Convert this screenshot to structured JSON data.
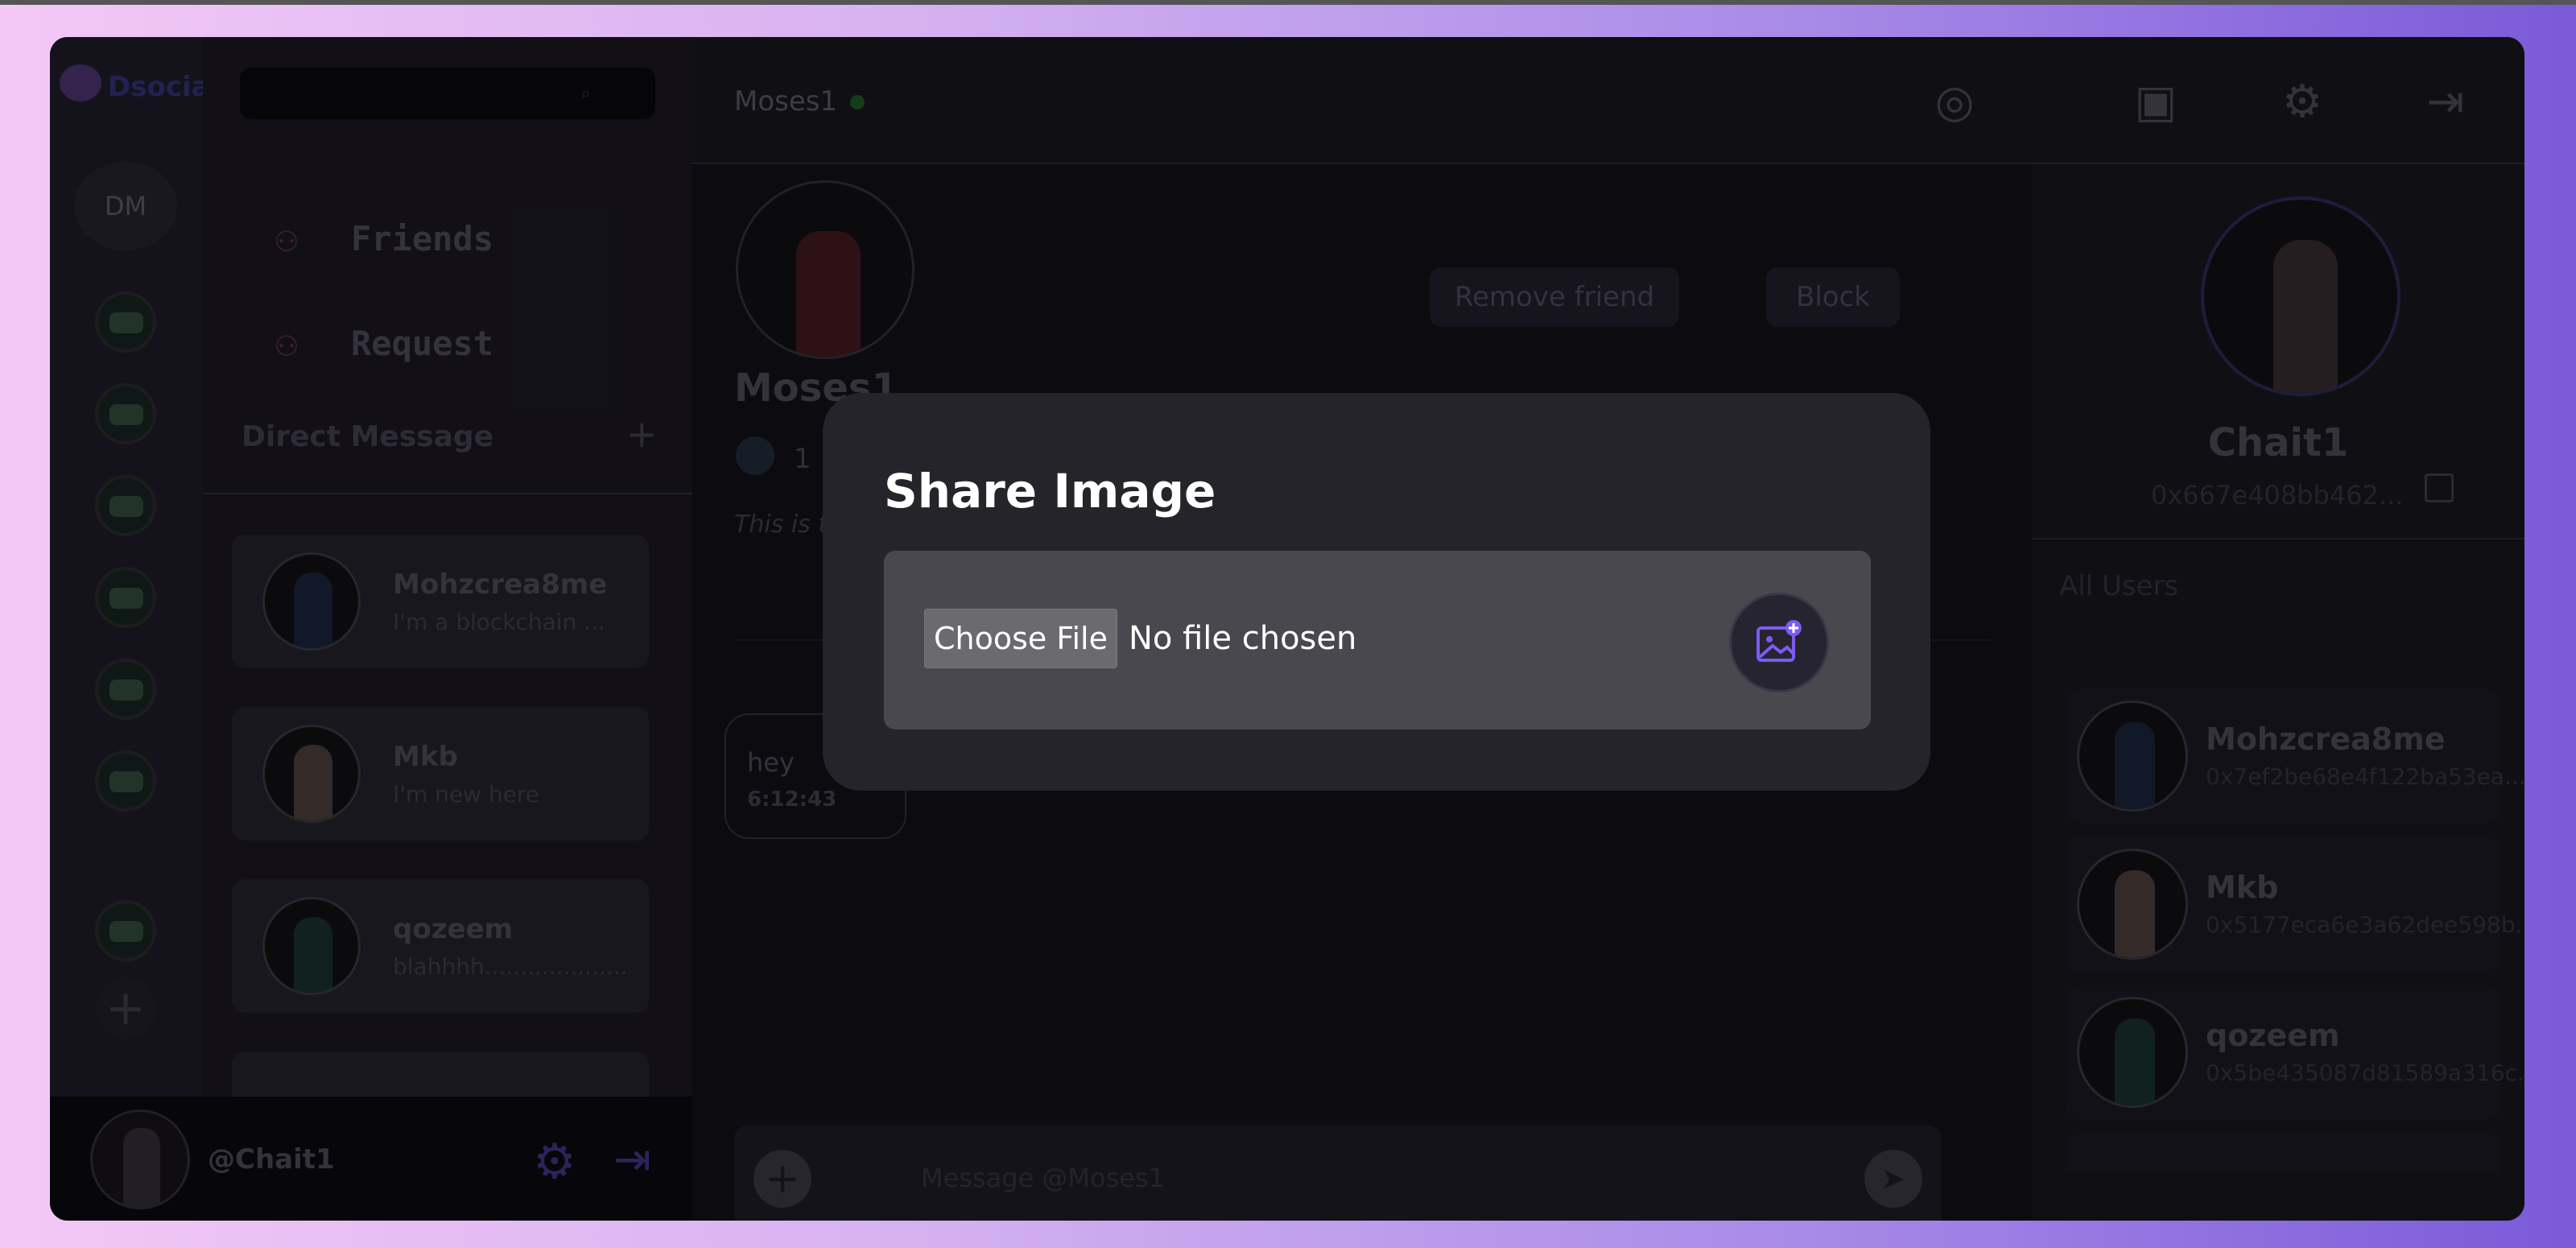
{
  "app": {
    "logo_text": "Dsocia",
    "dm_label": "DM"
  },
  "sidebar": {
    "friends_label": "Friends",
    "request_label": "Request",
    "direct_message_title": "Direct Message",
    "dms": [
      {
        "name": "Mohzcrea8me",
        "preview": "I'm a blockchain ..."
      },
      {
        "name": "Mkb",
        "preview": "I'm new here"
      },
      {
        "name": "qozeem",
        "preview": "blahhhh...................."
      }
    ]
  },
  "user": {
    "handle": "@Chait1"
  },
  "chat": {
    "header_title": "Moses1",
    "profile_name": "Moses1",
    "remove_friend_label": "Remove friend",
    "block_label": "Block",
    "stat_count": "1",
    "bio_preview": "This is t",
    "message_text": "hey",
    "message_time": "6:12:43",
    "composer_placeholder": "Message @Moses1"
  },
  "right_panel": {
    "name": "Chait1",
    "address": "0x667e408bb462...",
    "all_users_title": "All Users",
    "users": [
      {
        "name": "Mohzcrea8me",
        "address": "0x7ef2be68e4f122ba53ea..."
      },
      {
        "name": "Mkb",
        "address": "0x5177eca6e3a62dee598b..."
      },
      {
        "name": "qozeem",
        "address": "0x5be435087d81589a316c..."
      }
    ]
  },
  "modal": {
    "title": "Share Image",
    "choose_file_label": "Choose File",
    "no_file_text": "No file chosen"
  },
  "colors": {
    "accent": "#7c5cf0",
    "online": "#2bb24c"
  }
}
